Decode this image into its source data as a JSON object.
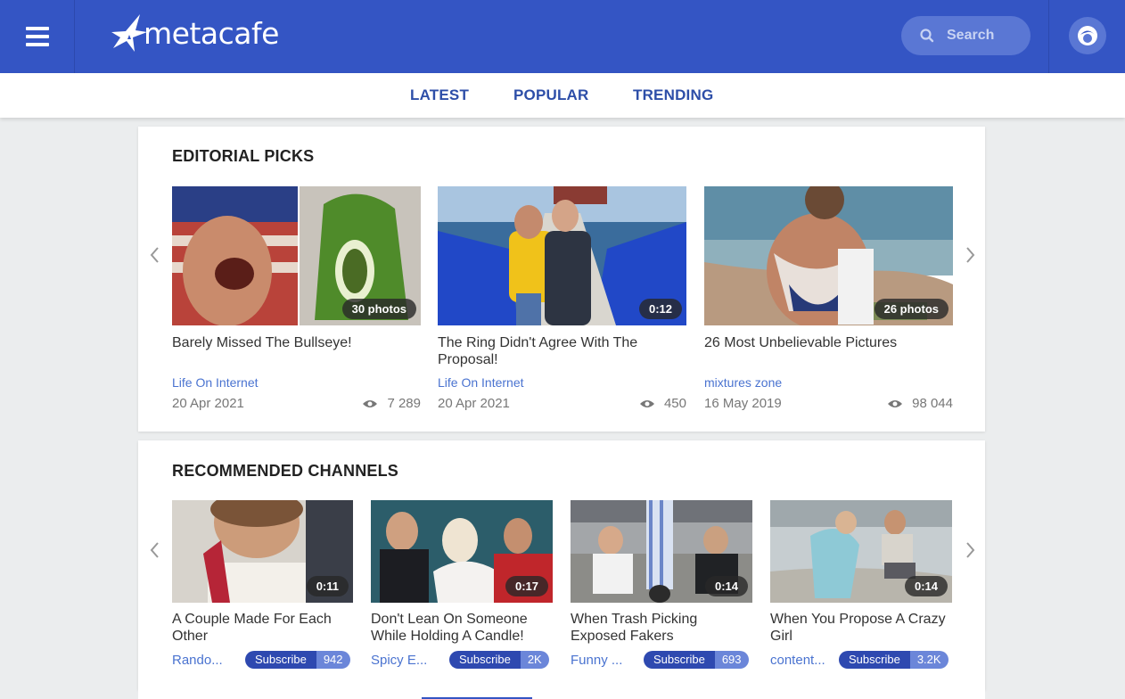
{
  "header": {
    "logo_text": "metacafe",
    "search_placeholder": "Search",
    "brand_color": "#3455c4"
  },
  "tabs": [
    {
      "label": "LATEST"
    },
    {
      "label": "POPULAR"
    },
    {
      "label": "TRENDING"
    }
  ],
  "editorial": {
    "title": "EDITORIAL PICKS",
    "items": [
      {
        "title": "Barely Missed The Bullseye!",
        "badge": "30 photos",
        "channel": "Life On Internet",
        "date": "20 Apr 2021",
        "views": "7 289"
      },
      {
        "title": "The Ring Didn't Agree With The Proposal!",
        "badge": "0:12",
        "channel": "Life On Internet",
        "date": "20 Apr 2021",
        "views": "450"
      },
      {
        "title": "26 Most Unbelievable Pictures",
        "badge": "26 photos",
        "channel": "mixtures zone",
        "date": "16 May 2019",
        "views": "98 044"
      }
    ]
  },
  "recommended": {
    "title": "RECOMMENDED CHANNELS",
    "subscribe_label": "Subscribe",
    "items": [
      {
        "title": "A Couple Made For Each Other",
        "badge": "0:11",
        "channel": "Rando...",
        "count": "942"
      },
      {
        "title": "Don't Lean On Someone While Holding A Candle!",
        "badge": "0:17",
        "channel": "Spicy E...",
        "count": "2K"
      },
      {
        "title": "When Trash Picking Exposed Fakers",
        "badge": "0:14",
        "channel": "Funny ...",
        "count": "693"
      },
      {
        "title": "When You Propose A Crazy Girl",
        "badge": "0:14",
        "channel": "content...",
        "count": "3.2K"
      }
    ]
  },
  "icons": {
    "menu": "menu-icon",
    "search": "search-icon",
    "user": "user-icon",
    "views": "eye-icon",
    "prev": "chevron-left-icon",
    "next": "chevron-right-icon"
  }
}
